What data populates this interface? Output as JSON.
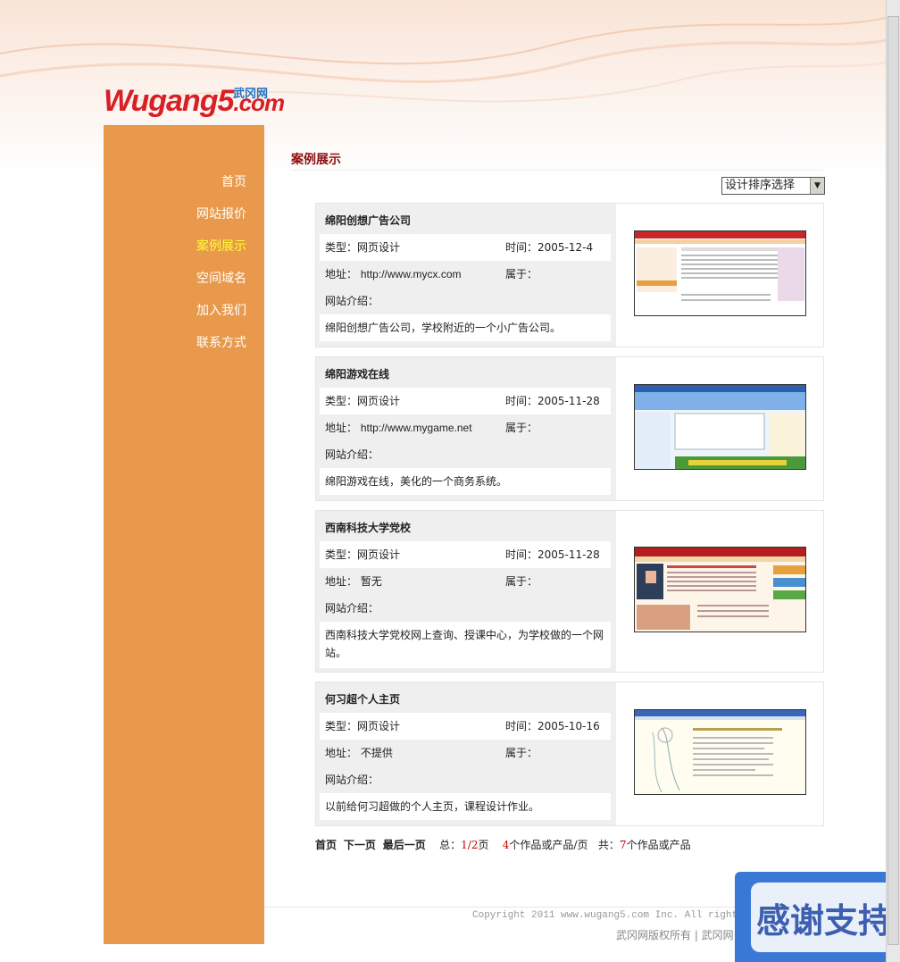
{
  "logo": {
    "wordmark": "Wugang5",
    "wordmark_suffix": ".com",
    "chinese": "武冈网"
  },
  "nav": {
    "items": [
      {
        "label": "首页"
      },
      {
        "label": "网站报价"
      },
      {
        "label": "案例展示",
        "active": true
      },
      {
        "label": "空间域名"
      },
      {
        "label": "加入我们"
      },
      {
        "label": "联系方式"
      }
    ]
  },
  "section": {
    "title": "案例展示"
  },
  "sort": {
    "selected": "设计排序选择"
  },
  "labels": {
    "type": "类型：",
    "time": "时间：",
    "address": "地址：",
    "belongs": "属于：",
    "intro": "网站介绍："
  },
  "cases": [
    {
      "name": "绵阳创想广告公司",
      "type": "网页设计",
      "time": "2005-12-4",
      "address": "http://www.mycx.com",
      "belongs": "",
      "intro": "绵阳创想广告公司，学校附近的一个小广告公司。"
    },
    {
      "name": "绵阳游戏在线",
      "type": "网页设计",
      "time": "2005-11-28",
      "address": "http://www.mygame.net",
      "belongs": "",
      "intro": "绵阳游戏在线，美化的一个商务系统。"
    },
    {
      "name": "西南科技大学党校",
      "type": "网页设计",
      "time": "2005-11-28",
      "address": "暂无",
      "belongs": "",
      "intro": "西南科技大学党校网上查询、授课中心，为学校做的一个网站。"
    },
    {
      "name": "何习超个人主页",
      "type": "网页设计",
      "time": "2005-10-16",
      "address": "不提供",
      "belongs": "",
      "intro": "以前给何习超做的个人主页，课程设计作业。"
    }
  ],
  "pager": {
    "first": "首页",
    "next": "下一页",
    "last": "最后一页",
    "total_prefix": "总：",
    "page": "1/2",
    "total_suffix": "页",
    "per_page": "4",
    "per_page_suffix": "个作品或产品/页",
    "count_prefix": "共：",
    "count": "7",
    "count_suffix": "个作品或产品"
  },
  "footer": {
    "copyright": "Copyright 2011 www.wugang5.com Inc. All rights re",
    "links": "武冈网版权所有 | 武冈网"
  },
  "thanks_banner": {
    "text": "感谢支持"
  },
  "colors": {
    "sidebar": "#e8994c",
    "nav_active": "#ffff33",
    "title": "#8b0f0f",
    "logo_red": "#d81f26"
  }
}
